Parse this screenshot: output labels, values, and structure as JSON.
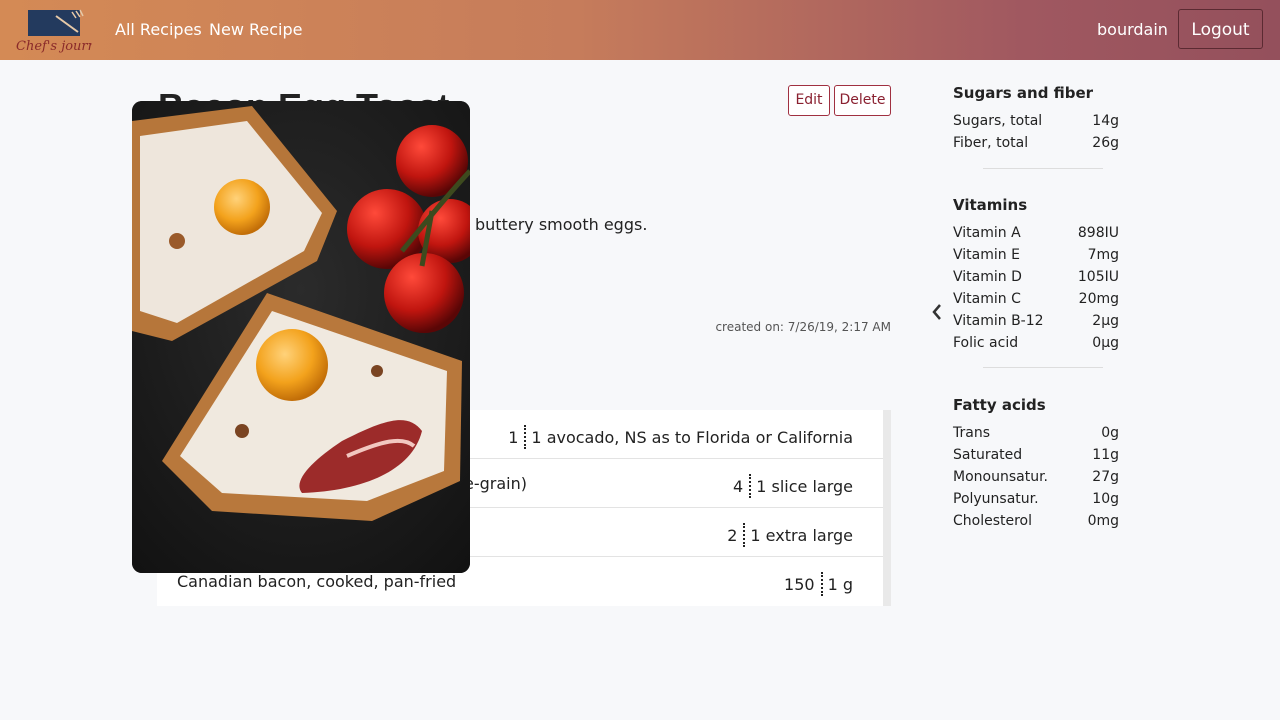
{
  "nav": {
    "logo_text": "Chef's journal",
    "links": [
      "All Recipes",
      "New Recipe"
    ],
    "user": "bourdain",
    "logout": "Logout"
  },
  "recipe": {
    "title": "Bacon Egg Toast",
    "description": "buttery smooth eggs.",
    "created": "created on: 7/26/19, 2:17 AM",
    "edit_label": "Edit",
    "delete_label": "Delete",
    "ingredients": [
      {
        "name": "",
        "qty": "1",
        "unit": "1 avocado, NS as to Florida or California"
      },
      {
        "name": "e-grain)",
        "qty": "4",
        "unit": "1 slice large"
      },
      {
        "name": "",
        "qty": "2",
        "unit": "1 extra large"
      },
      {
        "name": "Canadian bacon, cooked, pan-fried",
        "qty": "150",
        "unit": "1 g"
      }
    ]
  },
  "nutrition": {
    "sugars_title": "Sugars and fiber",
    "sugars": [
      {
        "label": "Sugars, total",
        "value": "14g"
      },
      {
        "label": "Fiber, total",
        "value": "26g"
      }
    ],
    "vitamins_title": "Vitamins",
    "vitamins": [
      {
        "label": "Vitamin A",
        "value": "898IU"
      },
      {
        "label": "Vitamin E",
        "value": "7mg"
      },
      {
        "label": "Vitamin D",
        "value": "105IU"
      },
      {
        "label": "Vitamin C",
        "value": "20mg"
      },
      {
        "label": "Vitamin B-12",
        "value": "2µg"
      },
      {
        "label": "Folic acid",
        "value": "0µg"
      }
    ],
    "fatty_title": "Fatty acids",
    "fatty": [
      {
        "label": "Trans",
        "value": "0g"
      },
      {
        "label": "Saturated",
        "value": "11g"
      },
      {
        "label": "Monounsatur.",
        "value": "27g"
      },
      {
        "label": "Polyunsatur.",
        "value": "10g"
      },
      {
        "label": "Cholesterol",
        "value": "0mg"
      }
    ]
  },
  "colors": {
    "accent": "#8a2030",
    "nav_start": "#d48a55",
    "nav_end": "#94505c"
  }
}
